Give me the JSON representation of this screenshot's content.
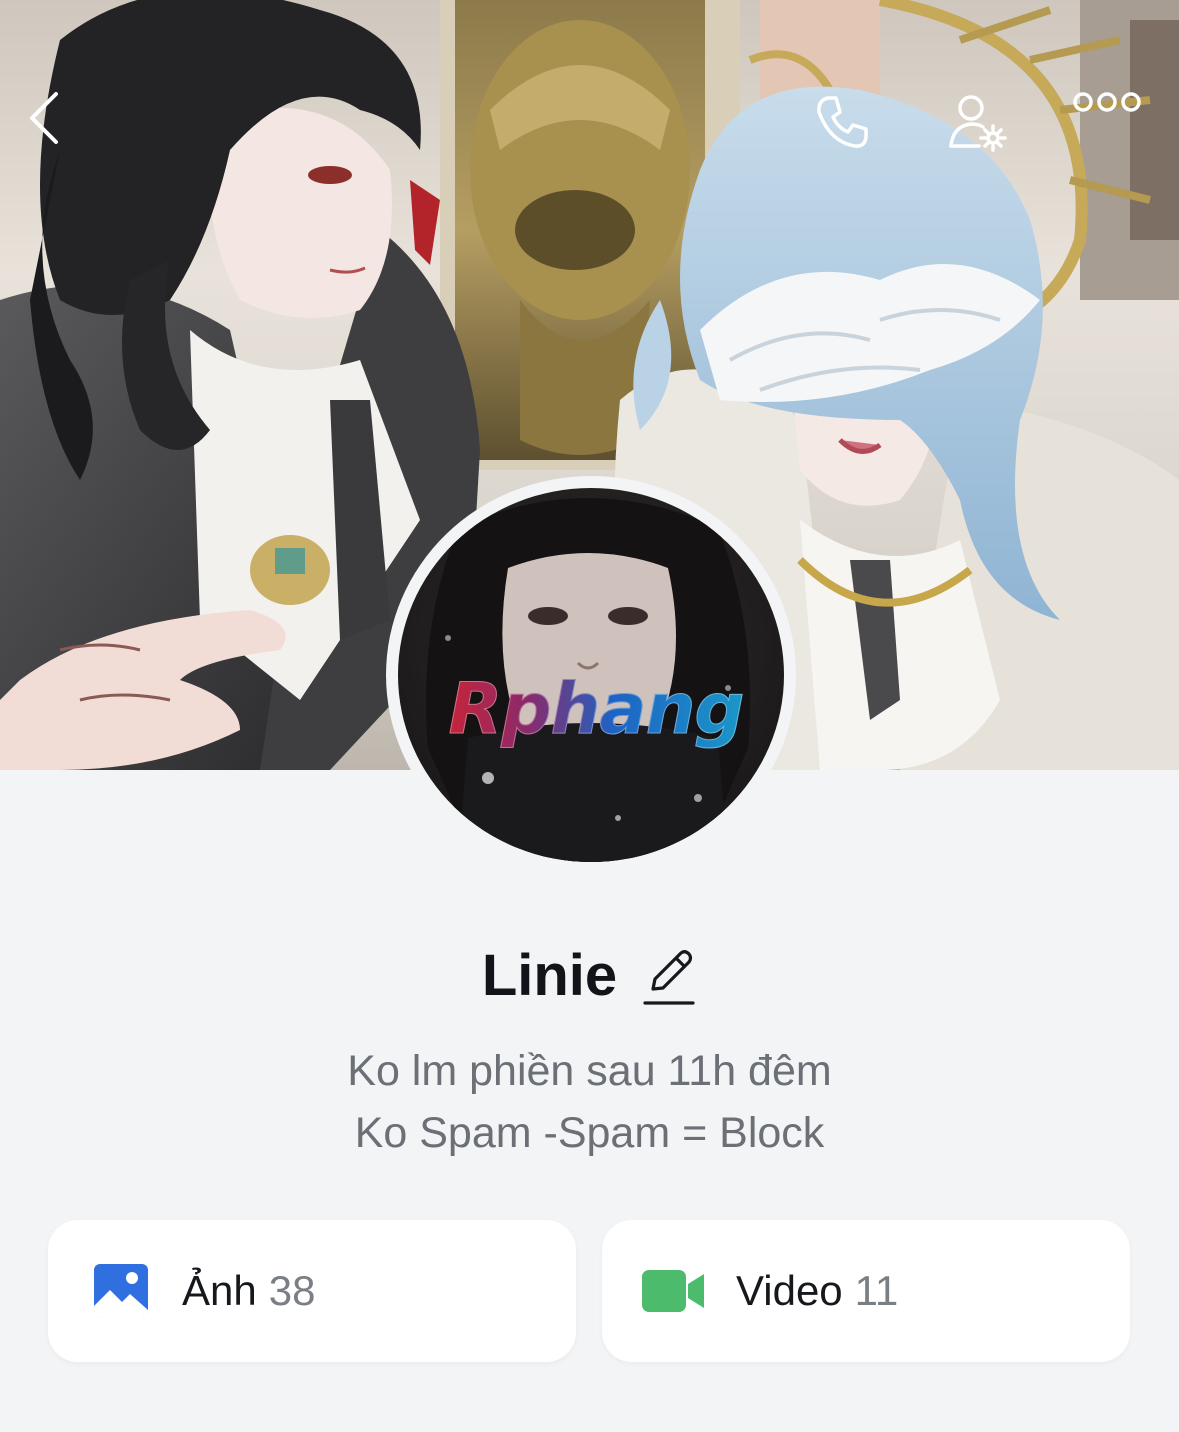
{
  "header": {
    "back_icon": "chevron-left-icon",
    "call_icon": "phone-icon",
    "settings_icon": "person-gear-icon",
    "more_icon": "more-dots-icon"
  },
  "profile": {
    "name": "Linie",
    "edit_icon": "pencil-icon",
    "avatar_watermark": "Rphang",
    "bio_line1": "Ko lm phiền sau 11h đêm",
    "bio_line2": "Ko Spam -Spam = Block"
  },
  "media": {
    "photos": {
      "label": "Ảnh",
      "count": "38",
      "icon": "image-icon",
      "color": "#2f6fe0"
    },
    "videos": {
      "label": "Video",
      "count": "11",
      "icon": "video-camera-icon",
      "color": "#4cbb6c"
    }
  },
  "colors": {
    "background": "#f3f4f6",
    "card": "#ffffff",
    "name": "#111418",
    "bio": "#6b6f76"
  }
}
